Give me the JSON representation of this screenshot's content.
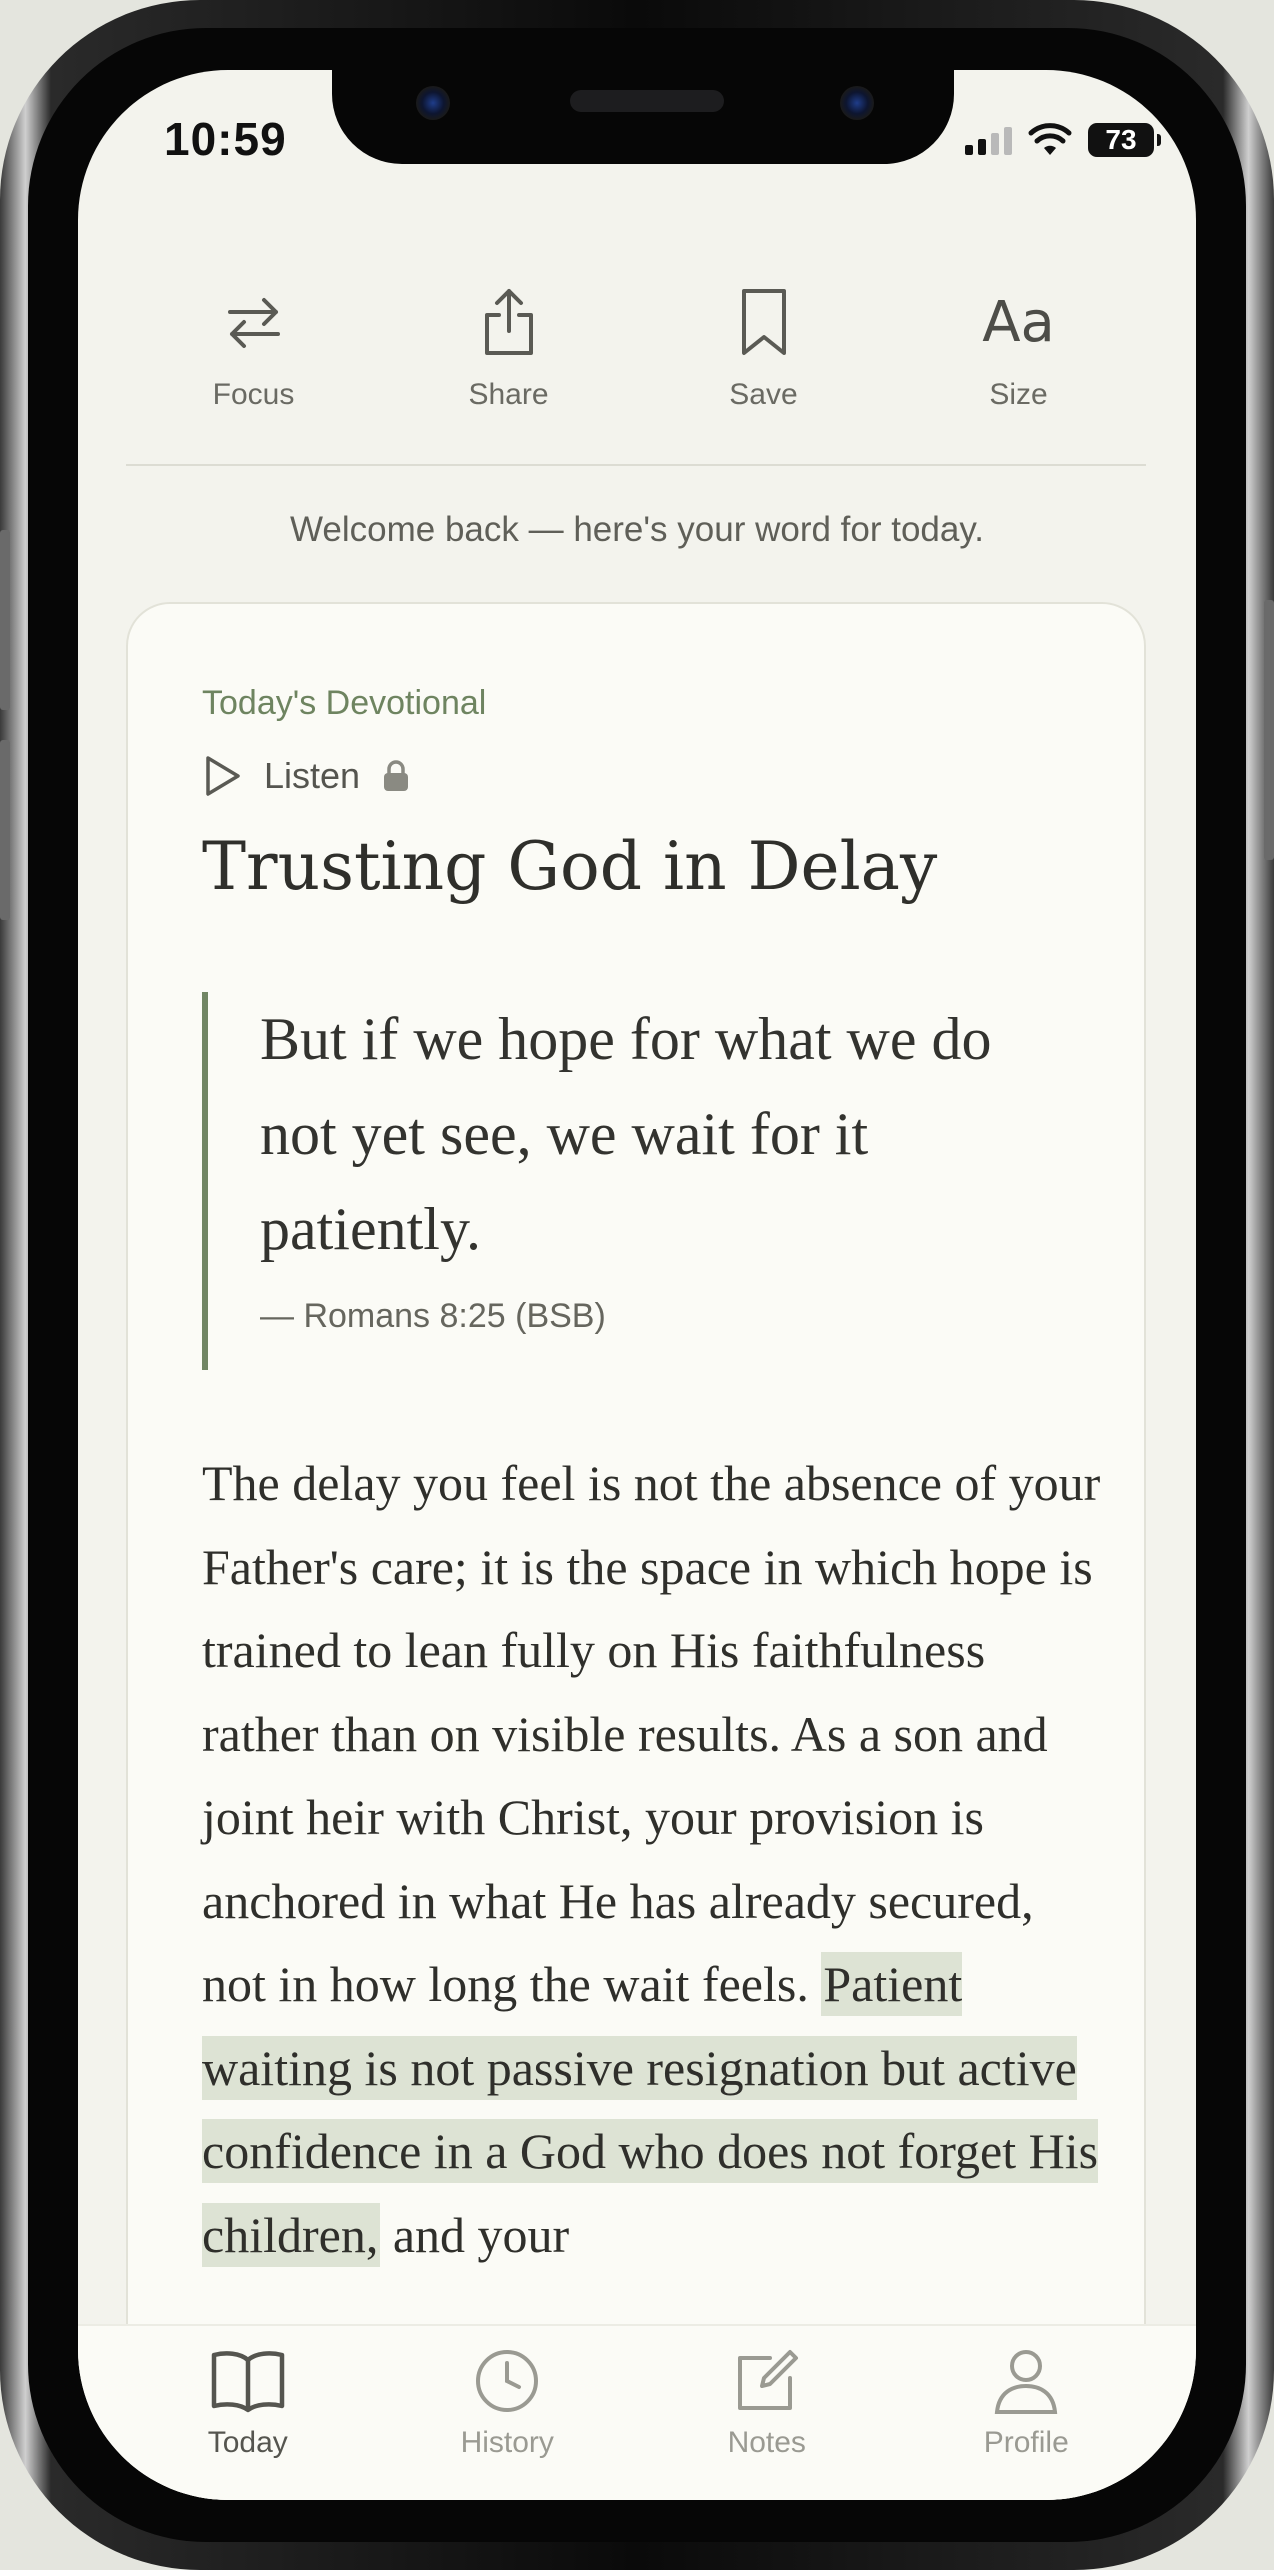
{
  "status_bar": {
    "time": "10:59",
    "battery": "73"
  },
  "toolbar": {
    "focus_label": "Focus",
    "share_label": "Share",
    "save_label": "Save",
    "size_icon_text": "Aa",
    "size_label": "Size"
  },
  "welcome": "Welcome back — here's your word for today.",
  "devotional": {
    "eyebrow": "Today's Devotional",
    "listen_label": "Listen",
    "title": "Trusting God in Delay",
    "quote_text": "But if we hope for what we do not yet see, we wait for it patiently.",
    "quote_reference": "— Romans 8:25 (BSB)",
    "body_plain": "The delay you feel is not the absence of your Father's care; it is the space in which hope is trained to lean fully on His faithfulness rather than on visible results. As a son and joint heir with Christ, your provision is anchored in what He has already secured, not in how long the wait feels. ",
    "body_highlighted": "Patient waiting is not passive resignation but active confidence in a God who does not forget His children,",
    "body_tail": " and your"
  },
  "tabbar": {
    "tabs": [
      {
        "label": "Today",
        "icon": "book-icon",
        "active": true
      },
      {
        "label": "History",
        "icon": "clock-icon",
        "active": false
      },
      {
        "label": "Notes",
        "icon": "edit-icon",
        "active": false
      },
      {
        "label": "Profile",
        "icon": "person-icon",
        "active": false
      }
    ]
  },
  "colors": {
    "accent_green": "#6e8460",
    "highlight": "#dde3d4",
    "screen_bg": "#f3f3ed",
    "card_bg": "#fbfbf6"
  }
}
